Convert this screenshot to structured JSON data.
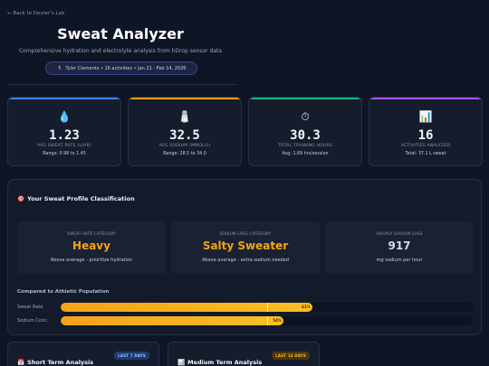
{
  "nav": {
    "back_label": "← Back to Dexter's Lab"
  },
  "header": {
    "title": "Sweat Analyzer",
    "subtitle": "Comprehensive hydration and electrolyte analysis from hDrop sensor data",
    "meta_pill": {
      "icon": "runner-icon",
      "text": "Tyler Clements  •  16 activities  •  Jan 21 - Feb 14, 2026"
    }
  },
  "stats": [
    {
      "icon": "💧",
      "icon_name": "droplet-icon",
      "value": "1.23",
      "label": "AVG SWEAT RATE (L/HR)",
      "range": "Range: 0.98 to 1.45",
      "accent": "#3b82f6"
    },
    {
      "icon": "🧂",
      "icon_name": "salt-shaker-icon",
      "value": "32.5",
      "label": "AVG SODIUM (MMOL/L)",
      "range": "Range: 28.5 to 34.0",
      "accent": "#f59e0b"
    },
    {
      "icon": "⏱",
      "icon_name": "stopwatch-icon",
      "value": "30.3",
      "label": "TOTAL TRAINING HOURS",
      "range": "Avg: 1.89 hrs/session",
      "accent": "#10b981"
    },
    {
      "icon": "📊",
      "icon_name": "bar-chart-icon",
      "value": "16",
      "label": "ACTIVITIES ANALYZED",
      "range": "Total: 37.1 L sweat",
      "accent": "#a855f7"
    }
  ],
  "profile": {
    "title_icon": "🎯",
    "title": "Your Sweat Profile Classification",
    "cards": [
      {
        "label": "SWEAT RATE CATEGORY",
        "value": "Heavy",
        "desc": "Above average - prioritize hydration",
        "color": "#f5a316"
      },
      {
        "label": "SODIUM LOSS CATEGORY",
        "value": "Salty Sweater",
        "desc": "Above average - extra sodium needed",
        "color": "#f5a316"
      },
      {
        "label": "HOURLY SODIUM LOSS",
        "value": "917",
        "desc": "mg sodium per hour",
        "color": "#d6dbe4"
      }
    ],
    "comparison_title": "Compared to Athletic Population",
    "bars": [
      {
        "label": "Sweat Rate",
        "percent": 61,
        "pct_label": "61%",
        "marker": 50
      },
      {
        "label": "Sodium Conc.",
        "percent": 54,
        "pct_label": "54%",
        "marker": 50
      }
    ]
  },
  "terms": [
    {
      "icon": "📅",
      "title": "Short Term Analysis",
      "badge": "LAST 7 DAYS",
      "badge_bg": "#1e3a6e",
      "badge_fg": "#93c5fd"
    },
    {
      "icon": "📊",
      "title": "Medium Term Analysis",
      "badge": "LAST 14 DAYS",
      "badge_bg": "#4a3510",
      "badge_fg": "#fbbf24"
    }
  ]
}
